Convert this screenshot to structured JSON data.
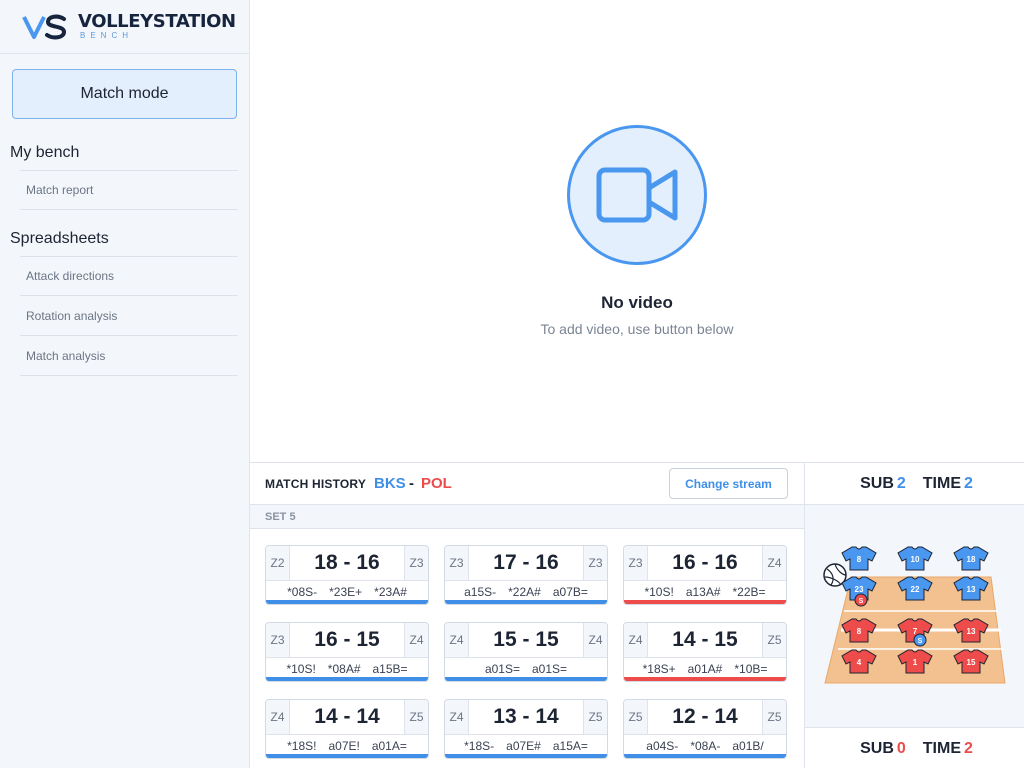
{
  "logo": {
    "title": "VOLLEYSTATION",
    "subtitle": "BENCH"
  },
  "sidebar": {
    "match_mode": "Match mode",
    "sections": [
      {
        "title": "My bench",
        "items": [
          "Match report"
        ]
      },
      {
        "title": "Spreadsheets",
        "items": [
          "Attack directions",
          "Rotation analysis",
          "Match analysis"
        ]
      }
    ]
  },
  "video": {
    "title": "No video",
    "subtitle": "To add video, use button below"
  },
  "history": {
    "title": "MATCH HISTORY",
    "home_team": "BKS",
    "separator": "-",
    "away_team": "POL",
    "change_stream": "Change stream",
    "set_label": "SET 5",
    "colors": {
      "home": "#3f8fe8",
      "away": "#ee4b4b"
    },
    "cards": [
      {
        "zone_left": "Z2",
        "score": "18 - 16",
        "zone_right": "Z3",
        "codes": [
          "*08S-",
          "*23E+",
          "*23A#"
        ],
        "team": "home"
      },
      {
        "zone_left": "Z3",
        "score": "17 - 16",
        "zone_right": "Z3",
        "codes": [
          "a15S-",
          "*22A#",
          "a07B="
        ],
        "team": "home"
      },
      {
        "zone_left": "Z3",
        "score": "16 - 16",
        "zone_right": "Z4",
        "codes": [
          "*10S!",
          "a13A#",
          "*22B="
        ],
        "team": "away"
      },
      {
        "zone_left": "Z3",
        "score": "16 - 15",
        "zone_right": "Z4",
        "codes": [
          "*10S!",
          "*08A#",
          "a15B="
        ],
        "team": "home"
      },
      {
        "zone_left": "Z4",
        "score": "15 - 15",
        "zone_right": "Z4",
        "codes": [
          "a01S=",
          "a01S="
        ],
        "team": "home"
      },
      {
        "zone_left": "Z4",
        "score": "14 - 15",
        "zone_right": "Z5",
        "codes": [
          "*18S+",
          "a01A#",
          "*10B="
        ],
        "team": "away"
      },
      {
        "zone_left": "Z4",
        "score": "14 - 14",
        "zone_right": "Z5",
        "codes": [
          "*18S!",
          "a07E!",
          "a01A="
        ],
        "team": "home"
      },
      {
        "zone_left": "Z4",
        "score": "13 - 14",
        "zone_right": "Z5",
        "codes": [
          "*18S-",
          "a07E#",
          "a15A="
        ],
        "team": "home"
      },
      {
        "zone_left": "Z5",
        "score": "12 - 14",
        "zone_right": "Z5",
        "codes": [
          "a04S-",
          "*08A-",
          "a01B/"
        ],
        "team": "home"
      }
    ]
  },
  "stats": {
    "top": {
      "sub_label": "SUB",
      "sub_value": "2",
      "time_label": "TIME",
      "time_value": "2",
      "color": "#3f8fe8"
    },
    "bottom": {
      "sub_label": "SUB",
      "sub_value": "0",
      "time_label": "TIME",
      "time_value": "2",
      "color": "#ee4b4b"
    }
  },
  "court": {
    "blue_back": [
      "8",
      "10",
      "18"
    ],
    "blue_front": [
      "23",
      "22",
      "13"
    ],
    "red_front": [
      "8",
      "7",
      "13"
    ],
    "red_back": [
      "4",
      "1",
      "15"
    ],
    "setter_badge": "S",
    "ball_icon": "volleyball-icon"
  }
}
